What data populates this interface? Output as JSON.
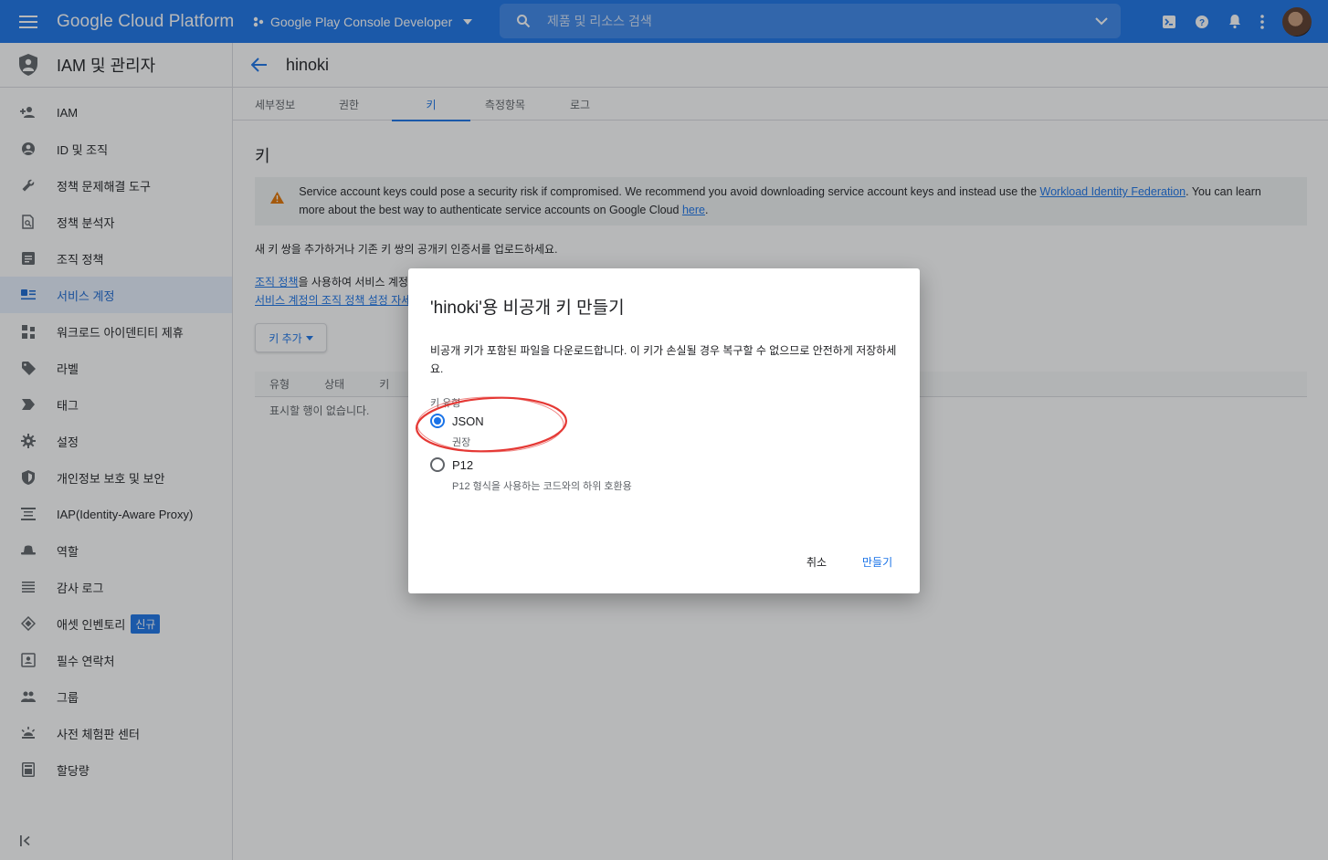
{
  "topbar": {
    "brand": "Google Cloud Platform",
    "project": "Google Play Console Developer",
    "search_placeholder": "제품 및 리소스 검색"
  },
  "sidebar": {
    "title": "IAM 및 관리자",
    "items": [
      {
        "label": "IAM",
        "icon": "person-add-icon"
      },
      {
        "label": "ID 및 조직",
        "icon": "account-circle-icon"
      },
      {
        "label": "정책 문제해결 도구",
        "icon": "wrench-icon"
      },
      {
        "label": "정책 분석자",
        "icon": "policy-analyzer-icon"
      },
      {
        "label": "조직 정책",
        "icon": "document-icon"
      },
      {
        "label": "서비스 계정",
        "icon": "service-account-icon",
        "active": true
      },
      {
        "label": "워크로드 아이덴티티 제휴",
        "icon": "workload-identity-icon"
      },
      {
        "label": "라벨",
        "icon": "label-icon"
      },
      {
        "label": "태그",
        "icon": "tag-icon"
      },
      {
        "label": "설정",
        "icon": "gear-icon"
      },
      {
        "label": "개인정보 보호 및 보안",
        "icon": "shield-icon"
      },
      {
        "label": "IAP(Identity-Aware Proxy)",
        "icon": "iap-icon"
      },
      {
        "label": "역할",
        "icon": "hat-icon"
      },
      {
        "label": "감사 로그",
        "icon": "list-icon"
      },
      {
        "label": "애셋 인벤토리",
        "icon": "diamond-icon",
        "badge": "신규"
      },
      {
        "label": "필수 연락처",
        "icon": "contact-icon"
      },
      {
        "label": "그룹",
        "icon": "group-icon"
      },
      {
        "label": "사전 체험판 센터",
        "icon": "early-access-icon"
      },
      {
        "label": "할당량",
        "icon": "quota-icon"
      }
    ]
  },
  "main": {
    "title": "hinoki",
    "tabs": [
      "세부정보",
      "권한",
      "키",
      "측정항목",
      "로그"
    ],
    "active_tab": "키",
    "section_title": "키",
    "warning": {
      "text_before": "Service account keys could pose a security risk if compromised. We recommend you avoid downloading service account keys and instead use the ",
      "link1": "Workload Identity Federation",
      "text_middle": ". You can learn more about the best way to authenticate service accounts on Google Cloud ",
      "link2": "here",
      "text_after": "."
    },
    "intro": "새 키 쌍을 추가하거나 기존 키 쌍의 공개키 인증서를 업로드하세요.",
    "org_link": "조직 정책",
    "org_text": "을 사용하여 서비스 계정",
    "org_link2": "서비스 계정의 조직 정책 설정 자세",
    "add_key": "키 추가",
    "table_headers": [
      "유형",
      "상태",
      "키",
      "키"
    ],
    "empty_row": "표시할 행이 없습니다."
  },
  "dialog": {
    "title": "'hinoki'용 비공개 키 만들기",
    "description": "비공개 키가 포함된 파일을 다운로드합니다. 이 키가 손실될 경우 복구할 수 없으므로 안전하게 저장하세요.",
    "key_type_label": "키 유형",
    "options": [
      {
        "label": "JSON",
        "sub": "권장",
        "selected": true
      },
      {
        "label": "P12",
        "sub": "P12 형식을 사용하는 코드와의 하위 호환용",
        "selected": false
      }
    ],
    "cancel": "취소",
    "create": "만들기"
  }
}
